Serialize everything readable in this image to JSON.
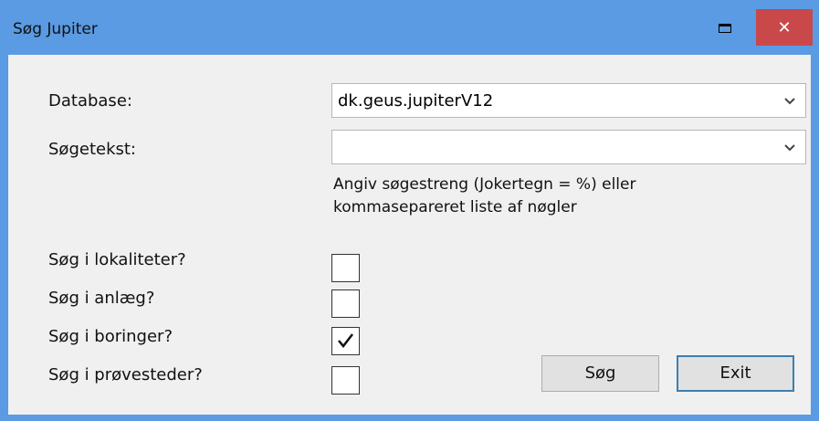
{
  "window": {
    "title": "Søg Jupiter",
    "close_glyph": "✕"
  },
  "form": {
    "database_label": "Database:",
    "database_value": "dk.geus.jupiterV12",
    "search_label": "Søgetekst:",
    "search_value": "",
    "hint_line1": "Angiv søgestreng (Jokertegn = %) eller",
    "hint_line2": "kommasepareret liste af nøgler"
  },
  "checkboxes": [
    {
      "label": "Søg i lokaliteter?",
      "checked": false
    },
    {
      "label": "Søg i anlæg?",
      "checked": false
    },
    {
      "label": "Søg i boringer?",
      "checked": true
    },
    {
      "label": "Søg i prøvesteder?",
      "checked": false
    }
  ],
  "buttons": {
    "search_label": "Søg",
    "exit_label": "Exit"
  },
  "colors": {
    "titlebar": "#5a9be3",
    "close": "#c9484a",
    "client": "#f0f0f0"
  }
}
